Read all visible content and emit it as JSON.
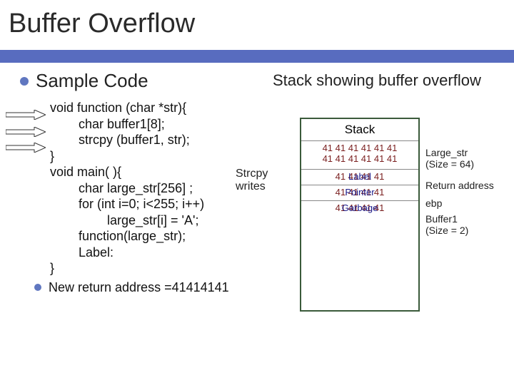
{
  "slide": {
    "title": "Buffer Overflow",
    "left_heading": "Sample Code",
    "right_heading": "Stack showing buffer overflow",
    "code": {
      "l1": "void function (char *str){",
      "l2": "        char buffer1[8];",
      "l3": "        strcpy (buffer1, str);",
      "l4": "}",
      "l5": "void main( ){",
      "l6": "        char large_str[256] ;",
      "l7": "        for (int i=0; i<255; i++)",
      "l8": "                large_str[i] = 'A';",
      "l9": "        function(large_str);",
      "l10": "        Label:",
      "l11": "}",
      "note": "New return address =41414141"
    },
    "strcpy_label": "Strcpy\nwrites",
    "stack": {
      "header": "Stack",
      "rows": [
        {
          "bytes": "41 41 41 41 41 41\n41 41 41 41 41 41",
          "overlay": ""
        },
        {
          "bytes": "41 41 41 41",
          "overlay": "Label"
        },
        {
          "bytes": "41 41 41 41",
          "overlay": "Pointer"
        },
        {
          "bytes": "41 41 41 41",
          "overlay": "Garbage"
        }
      ]
    },
    "legend": {
      "l1": "Large_str\n(Size = 64)",
      "l2": "Return address",
      "l3": "ebp",
      "l4": "Buffer1\n(Size = 2)"
    }
  }
}
